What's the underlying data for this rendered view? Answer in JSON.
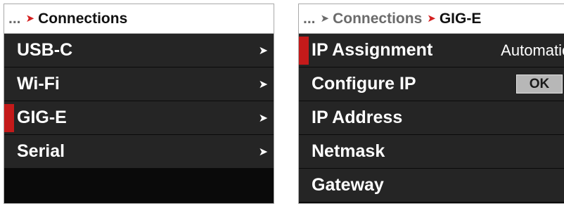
{
  "left_panel": {
    "breadcrumb": {
      "ellipsis": "...",
      "separator": "➤",
      "current": "Connections"
    },
    "items": [
      {
        "label": "USB-C",
        "selected": false,
        "chevron": "➤"
      },
      {
        "label": "Wi-Fi",
        "selected": false,
        "chevron": "➤"
      },
      {
        "label": "GIG-E",
        "selected": true,
        "chevron": "➤"
      },
      {
        "label": "Serial",
        "selected": false,
        "chevron": "➤"
      }
    ]
  },
  "right_panel": {
    "breadcrumb": {
      "ellipsis": "...",
      "separator": "➤",
      "parent": "Connections",
      "current": "GIG-E"
    },
    "items": [
      {
        "label": "IP Assignment",
        "value": "Automatic",
        "selected": true
      },
      {
        "label": "Configure IP",
        "button": "OK",
        "selected": false
      },
      {
        "label": "IP Address",
        "selected": false
      },
      {
        "label": "Netmask",
        "selected": false
      },
      {
        "label": "Gateway",
        "selected": false
      }
    ]
  },
  "colors": {
    "accent_red": "#c41a1a",
    "row_bg": "#252525",
    "panel_bg": "#0d0d0d"
  }
}
